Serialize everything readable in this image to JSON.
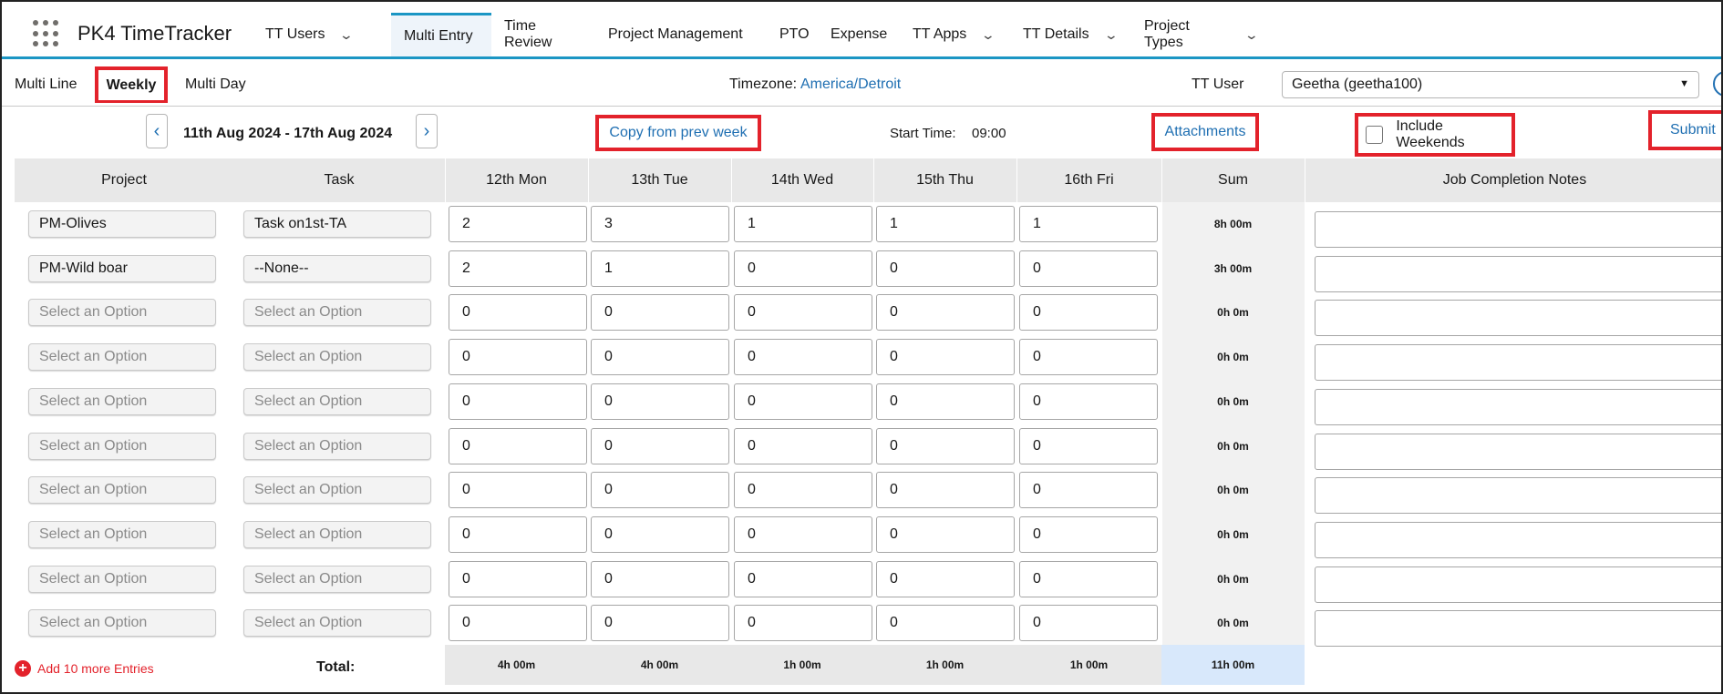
{
  "app": {
    "name": "PK4 TimeTracker"
  },
  "nav": [
    {
      "label": "TT Users",
      "dropdown": true
    },
    {
      "label": "Multi Entry",
      "dropdown": false,
      "active": true
    },
    {
      "label": "Time Review",
      "dropdown": false
    },
    {
      "label": "Project Management",
      "dropdown": false
    },
    {
      "label": "PTO",
      "dropdown": false
    },
    {
      "label": "Expense",
      "dropdown": false
    },
    {
      "label": "TT Apps",
      "dropdown": true
    },
    {
      "label": "TT Details",
      "dropdown": true
    },
    {
      "label": "Project Types",
      "dropdown": true
    }
  ],
  "subtabs": {
    "multi_line": "Multi Line",
    "weekly": "Weekly",
    "multi_day": "Multi Day"
  },
  "timezone": {
    "label": "Timezone:",
    "value": "America/Detroit"
  },
  "tt_user": {
    "label": "TT User",
    "value": "Geetha (geetha100)"
  },
  "controls": {
    "week_range": "11th Aug 2024 - 17th Aug 2024",
    "copy_prev": "Copy from prev week",
    "start_label": "Start Time:",
    "start_value": "09:00",
    "attachments": "Attachments",
    "include_weekends": "Include Weekends",
    "submit": "Submit"
  },
  "table": {
    "headers": [
      "Project",
      "Task",
      "12th Mon",
      "13th Tue",
      "14th Wed",
      "15th Thu",
      "16th Fri",
      "Sum",
      "Job Completion Notes"
    ],
    "rows": [
      {
        "project": "PM-Olives",
        "task": "Task on1st-TA",
        "project_placeholder": false,
        "task_placeholder": false,
        "hours": [
          "2",
          "3",
          "1",
          "1",
          "1"
        ],
        "sum": "8h 00m"
      },
      {
        "project": "PM-Wild boar",
        "task": "--None--",
        "project_placeholder": false,
        "task_placeholder": false,
        "hours": [
          "2",
          "1",
          "0",
          "0",
          "0"
        ],
        "sum": "3h 00m"
      },
      {
        "project": "Select an Option",
        "task": "Select an Option",
        "project_placeholder": true,
        "task_placeholder": true,
        "hours": [
          "0",
          "0",
          "0",
          "0",
          "0"
        ],
        "sum": "0h 0m"
      },
      {
        "project": "Select an Option",
        "task": "Select an Option",
        "project_placeholder": true,
        "task_placeholder": true,
        "hours": [
          "0",
          "0",
          "0",
          "0",
          "0"
        ],
        "sum": "0h 0m"
      },
      {
        "project": "Select an Option",
        "task": "Select an Option",
        "project_placeholder": true,
        "task_placeholder": true,
        "hours": [
          "0",
          "0",
          "0",
          "0",
          "0"
        ],
        "sum": "0h 0m"
      },
      {
        "project": "Select an Option",
        "task": "Select an Option",
        "project_placeholder": true,
        "task_placeholder": true,
        "hours": [
          "0",
          "0",
          "0",
          "0",
          "0"
        ],
        "sum": "0h 0m"
      },
      {
        "project": "Select an Option",
        "task": "Select an Option",
        "project_placeholder": true,
        "task_placeholder": true,
        "hours": [
          "0",
          "0",
          "0",
          "0",
          "0"
        ],
        "sum": "0h 0m"
      },
      {
        "project": "Select an Option",
        "task": "Select an Option",
        "project_placeholder": true,
        "task_placeholder": true,
        "hours": [
          "0",
          "0",
          "0",
          "0",
          "0"
        ],
        "sum": "0h 0m"
      },
      {
        "project": "Select an Option",
        "task": "Select an Option",
        "project_placeholder": true,
        "task_placeholder": true,
        "hours": [
          "0",
          "0",
          "0",
          "0",
          "0"
        ],
        "sum": "0h 0m"
      },
      {
        "project": "Select an Option",
        "task": "Select an Option",
        "project_placeholder": true,
        "task_placeholder": true,
        "hours": [
          "0",
          "0",
          "0",
          "0",
          "0"
        ],
        "sum": "0h 0m"
      }
    ],
    "totals": [
      "4h 00m",
      "4h 00m",
      "1h 00m",
      "1h 00m",
      "1h 00m"
    ],
    "grand_total": "11h 00m",
    "total_label": "Total:",
    "add_entries": "Add 10 more Entries"
  },
  "colors": {
    "accent": "#1b96c4",
    "link": "#1f6fb2",
    "highlight": "#e3222b",
    "grand_total_bg": "#d8e8fb"
  }
}
